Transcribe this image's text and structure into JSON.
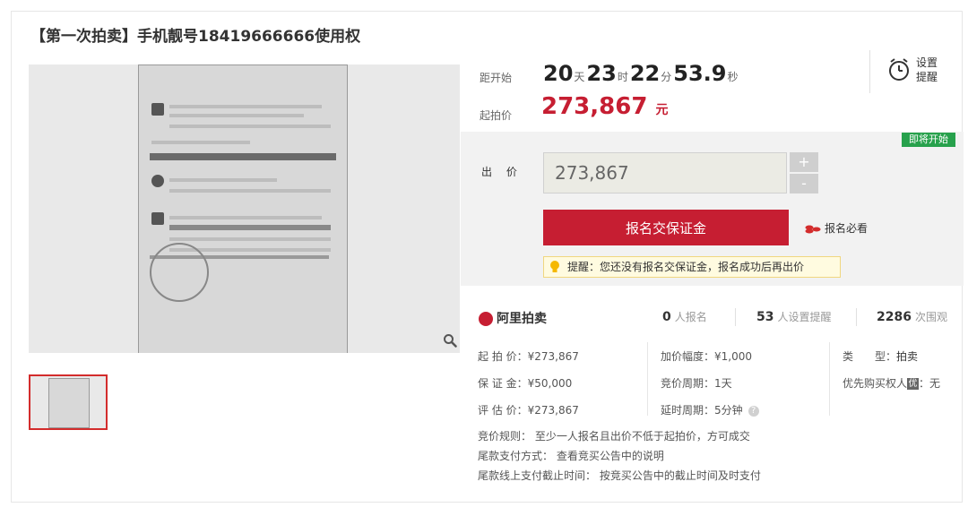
{
  "title": {
    "prefix": "【第一次拍卖】手机靓号",
    "number": "18419666666",
    "suffix": "使用权"
  },
  "countdown": {
    "label": "距开始",
    "days": "20",
    "days_unit": "天",
    "hours": "23",
    "hours_unit": "时",
    "minutes": "22",
    "minutes_unit": "分",
    "seconds": "53.9",
    "seconds_unit": "秒"
  },
  "reminder": {
    "line1": "设置",
    "line2": "提醒"
  },
  "start_price": {
    "label": "起拍价",
    "value": "273,867",
    "unit": "元"
  },
  "status_tag": "即将开始",
  "bid": {
    "label": "出 价",
    "value": "273,867",
    "plus": "+",
    "minus": "-"
  },
  "apply_button": "报名交保证金",
  "must_read": "报名必看",
  "tip": "提醒：您还没有报名交保证金，报名成功后再出价",
  "platform": "阿里拍卖",
  "stats": {
    "signed": "0",
    "signed_label": "人报名",
    "reminders": "53",
    "reminders_label": "人设置提醒",
    "viewers": "2286",
    "viewers_label": "次围观"
  },
  "details": {
    "start_price": "起 拍 价：¥273,867",
    "deposit": "保 证 金：¥50,000",
    "appraisal": "评 估 价：¥273,867",
    "increment": "加价幅度：¥1,000",
    "period": "竞价周期：1天",
    "extension": "延时周期：5分钟",
    "type_label": "类　　型：",
    "type_value": "拍卖",
    "priority_label": "优先购买权人",
    "priority_badge": "优",
    "priority_value": "：无",
    "help": "?"
  },
  "rules": {
    "rule1": "竞价规则：  至少一人报名且出价不低于起拍价，方可成交",
    "rule2": "尾款支付方式：  查看竞买公告中的说明",
    "rule3": "尾款线上支付截止时间：  按竞买公告中的截止时间及时支付"
  },
  "colors": {
    "accent": "#c61e32",
    "tag_green": "#27a14c",
    "tip_bg": "#fffbe0"
  },
  "icons": [
    "zoom-icon",
    "clock-icon",
    "coins-icon",
    "bulb-icon",
    "ali-logo-icon"
  ]
}
